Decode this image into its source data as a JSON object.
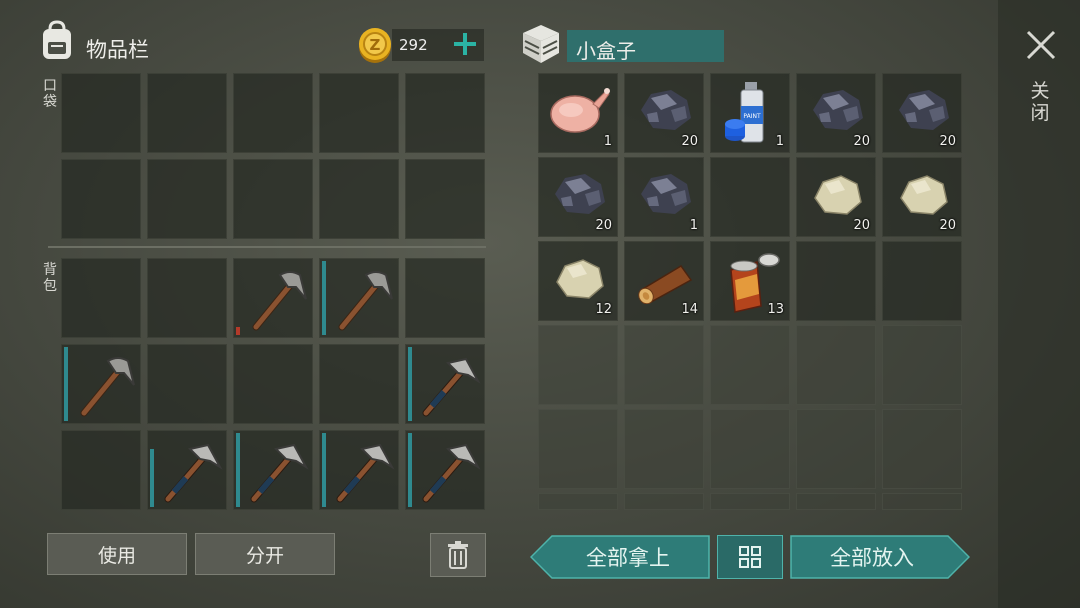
{
  "inventory": {
    "title": "物品栏",
    "coins": "292",
    "section_pocket": "口袋",
    "section_backpack": "背包",
    "use_label": "使用",
    "split_label": "分开"
  },
  "container": {
    "title": "小盒子",
    "close_label": "关闭",
    "take_all_label": "全部拿上",
    "put_all_label": "全部放入",
    "items": [
      {
        "icon": "raw-chicken-icon",
        "qty": "1"
      },
      {
        "icon": "coal-ore-icon",
        "qty": "20"
      },
      {
        "icon": "paint-spray-can-icon",
        "qty": "1"
      },
      {
        "icon": "coal-ore-icon",
        "qty": "20"
      },
      {
        "icon": "coal-ore-icon",
        "qty": "20"
      },
      {
        "icon": "coal-ore-icon",
        "qty": "20"
      },
      {
        "icon": "coal-ore-icon",
        "qty": "1"
      },
      {
        "icon": "stone-icon",
        "qty": "20"
      },
      {
        "icon": "stone-icon",
        "qty": "20"
      },
      {
        "icon": "stone-icon",
        "qty": "12"
      },
      {
        "icon": "wood-log-icon",
        "qty": "14"
      },
      {
        "icon": "canned-food-icon",
        "qty": "13"
      }
    ]
  },
  "colors": {
    "accent_teal": "#2e7c78",
    "durability_teal": "#2f8a8f",
    "durability_low": "#b33a2a"
  }
}
